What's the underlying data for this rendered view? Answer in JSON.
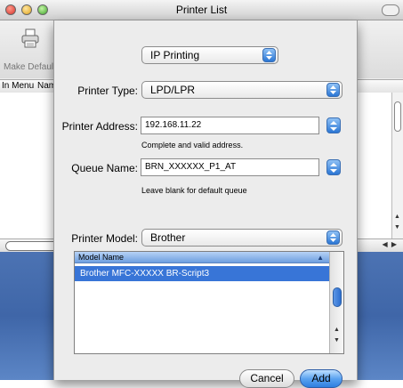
{
  "window": {
    "title": "Printer List",
    "toolbar": {
      "make_default_label": "Make Default"
    },
    "columns": {
      "in_menu": "In Menu",
      "name": "Nam"
    }
  },
  "sheet": {
    "protocol_popup": "IP Printing",
    "printer_type": {
      "label": "Printer Type:",
      "value": "LPD/LPR"
    },
    "printer_address": {
      "label": "Printer Address:",
      "value": "192.168.11.22",
      "hint": "Complete and valid address."
    },
    "queue_name": {
      "label": "Queue Name:",
      "value": "BRN_XXXXXX_P1_AT",
      "hint": "Leave blank for default queue"
    },
    "printer_model": {
      "label": "Printer Model:",
      "value": "Brother"
    },
    "model_list": {
      "header": "Model Name",
      "rows": [
        "Brother MFC-XXXXX BR-Script3"
      ],
      "selected_index": 0
    },
    "buttons": {
      "cancel": "Cancel",
      "add": "Add"
    }
  },
  "colors": {
    "selection": "#3875d7",
    "desktop_blue": "#4c73b3",
    "aqua_button": "#2f7fe0"
  },
  "icons": {
    "toolbar": "printer-icon",
    "stepper": "up-down-arrows-icon"
  }
}
